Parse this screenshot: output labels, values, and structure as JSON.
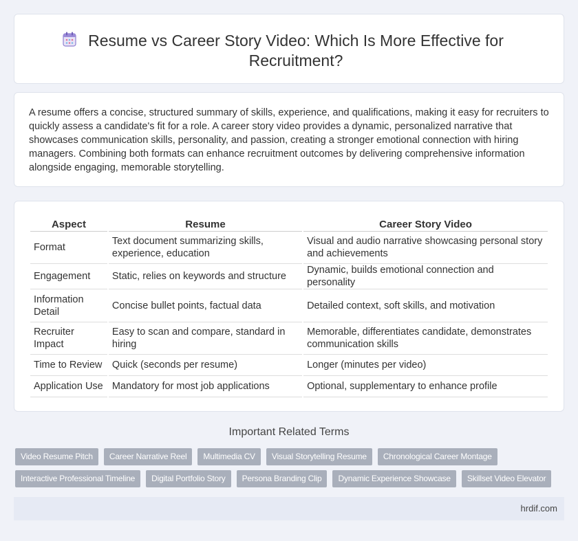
{
  "header": {
    "title": "Resume vs Career Story Video: Which Is More Effective for Recruitment?",
    "icon": "calendar-icon"
  },
  "summary": "A resume offers a concise, structured summary of skills, experience, and qualifications, making it easy for recruiters to quickly assess a candidate's fit for a role. A career story video provides a dynamic, personalized narrative that showcases communication skills, personality, and passion, creating a stronger emotional connection with hiring managers. Combining both formats can enhance recruitment outcomes by delivering comprehensive information alongside engaging, memorable storytelling.",
  "table": {
    "headers": [
      "Aspect",
      "Resume",
      "Career Story Video"
    ],
    "rows": [
      [
        "Format",
        "Text document summarizing skills, experience, education",
        "Visual and audio narrative showcasing personal story and achievements"
      ],
      [
        "Engagement",
        "Static, relies on keywords and structure",
        "Dynamic, builds emotional connection and personality"
      ],
      [
        "Information Detail",
        "Concise bullet points, factual data",
        "Detailed context, soft skills, and motivation"
      ],
      [
        "Recruiter Impact",
        "Easy to scan and compare, standard in hiring",
        "Memorable, differentiates candidate, demonstrates communication skills"
      ],
      [
        "Time to Review",
        "Quick (seconds per resume)",
        "Longer (minutes per video)"
      ],
      [
        "Application Use",
        "Mandatory for most job applications",
        "Optional, supplementary to enhance profile"
      ]
    ]
  },
  "related": {
    "title": "Important Related Terms",
    "tags_row1": [
      "Video Resume Pitch",
      "Career Narrative Reel",
      "Multimedia CV",
      "Visual Storytelling Resume",
      "Chronological Career Montage"
    ],
    "tags_row2": [
      "Interactive Professional Timeline",
      "Digital Portfolio Story",
      "Persona Branding Clip",
      "Dynamic Experience Showcase",
      "Skillset Video Elevator"
    ]
  },
  "footer": {
    "site": "hrdif.com"
  },
  "colors": {
    "background": "#f0f2f8",
    "tag": "#a9afbb",
    "footer": "#e6eaf4"
  }
}
